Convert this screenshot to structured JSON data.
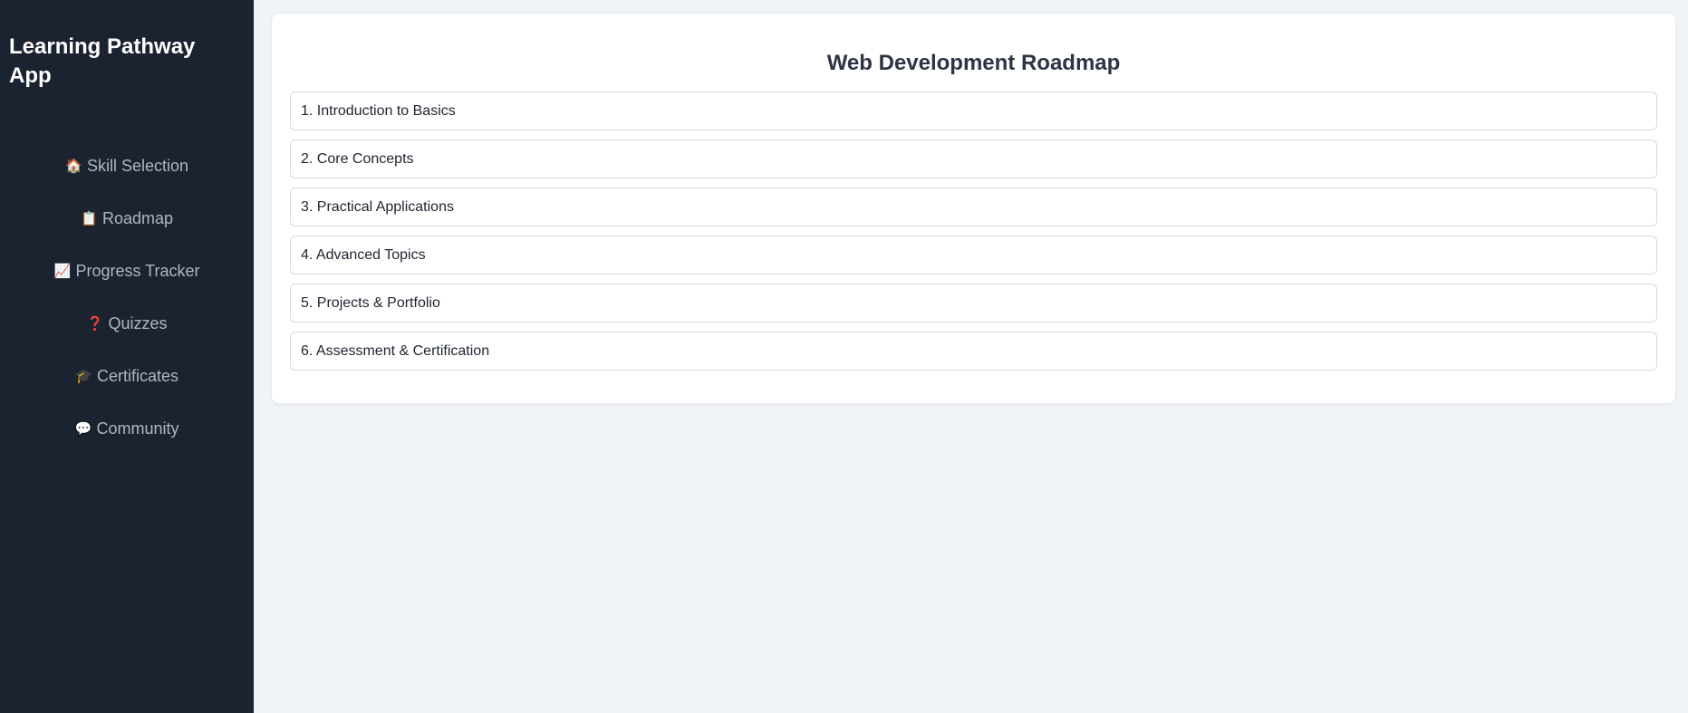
{
  "sidebar": {
    "brand": "Learning Pathway App",
    "items": [
      {
        "icon": "🏠",
        "icon_name": "home-icon",
        "label": "Skill Selection"
      },
      {
        "icon": "📋",
        "icon_name": "clipboard-icon",
        "label": "Roadmap"
      },
      {
        "icon": "📈",
        "icon_name": "chart-icon",
        "label": "Progress Tracker"
      },
      {
        "icon": "❓",
        "icon_name": "question-icon",
        "label": "Quizzes"
      },
      {
        "icon": "🎓",
        "icon_name": "graduation-cap-icon",
        "label": "Certificates"
      },
      {
        "icon": "💬",
        "icon_name": "speech-bubble-icon",
        "label": "Community"
      }
    ]
  },
  "main": {
    "title": "Web Development Roadmap",
    "steps": [
      "1. Introduction to Basics",
      "2. Core Concepts",
      "3. Practical Applications",
      "4. Advanced Topics",
      "5. Projects & Portfolio",
      "6. Assessment & Certification"
    ]
  },
  "colors": {
    "sidebar_bg": "#1c2330",
    "page_bg": "#f0f3f7",
    "title": "#2c3445"
  }
}
